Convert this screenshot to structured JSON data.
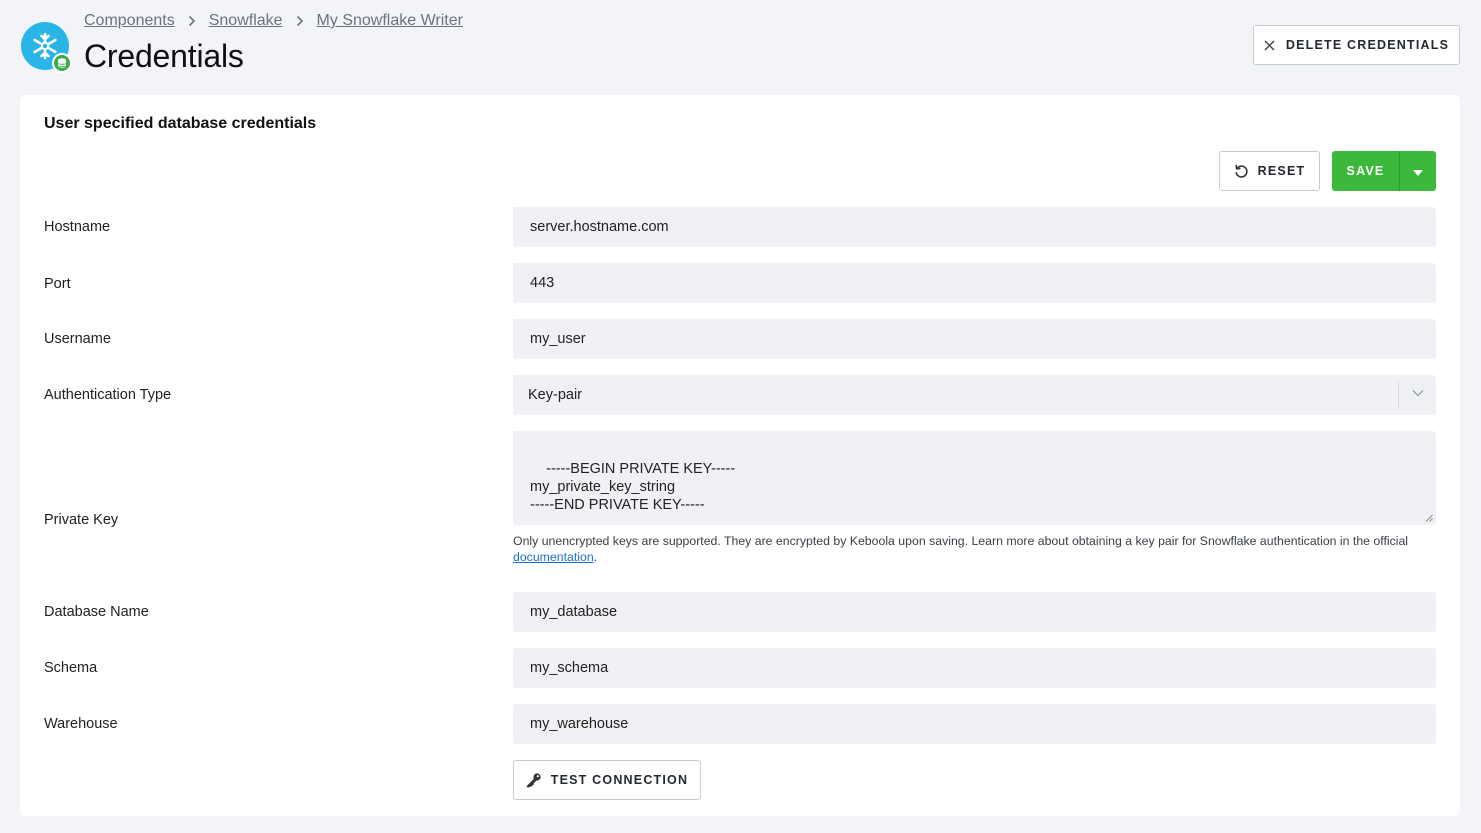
{
  "breadcrumb": {
    "items": [
      "Components",
      "Snowflake",
      "My Snowflake Writer"
    ]
  },
  "page": {
    "title": "Credentials",
    "delete_label": "Delete Credentials"
  },
  "card": {
    "title": "User specified database credentials",
    "reset_label": "Reset",
    "save_label": "Save"
  },
  "fields": {
    "hostname": {
      "label": "Hostname",
      "value": "server.hostname.com"
    },
    "port": {
      "label": "Port",
      "value": "443"
    },
    "username": {
      "label": "Username",
      "value": "my_user"
    },
    "auth_type": {
      "label": "Authentication Type",
      "value": "Key-pair"
    },
    "private_key": {
      "label": "Private Key",
      "value": "-----BEGIN PRIVATE KEY-----\nmy_private_key_string\n-----END PRIVATE KEY-----",
      "help_prefix": "Only unencrypted keys are supported. They are encrypted by Keboola upon saving. Learn more about obtaining a key pair for Snowflake authentication in the official ",
      "help_link": "documentation",
      "help_suffix": "."
    },
    "database": {
      "label": "Database Name",
      "value": "my_database"
    },
    "schema": {
      "label": "Schema",
      "value": "my_schema"
    },
    "warehouse": {
      "label": "Warehouse",
      "value": "my_warehouse"
    }
  },
  "test_connection_label": "Test Connection",
  "icons": {
    "logo": "snowflake-icon",
    "badge": "database-icon",
    "delete": "close-icon",
    "reset": "undo-icon",
    "save_menu": "caret-down-icon",
    "select": "chevron-down-icon",
    "test": "key-icon"
  },
  "colors": {
    "background": "#f2f4f7",
    "card": "#ffffff",
    "input": "#eff1f4",
    "save": "#3cb93c",
    "logo": "#29b5e8",
    "badge": "#3dab4c",
    "link": "#1a6fd1"
  }
}
